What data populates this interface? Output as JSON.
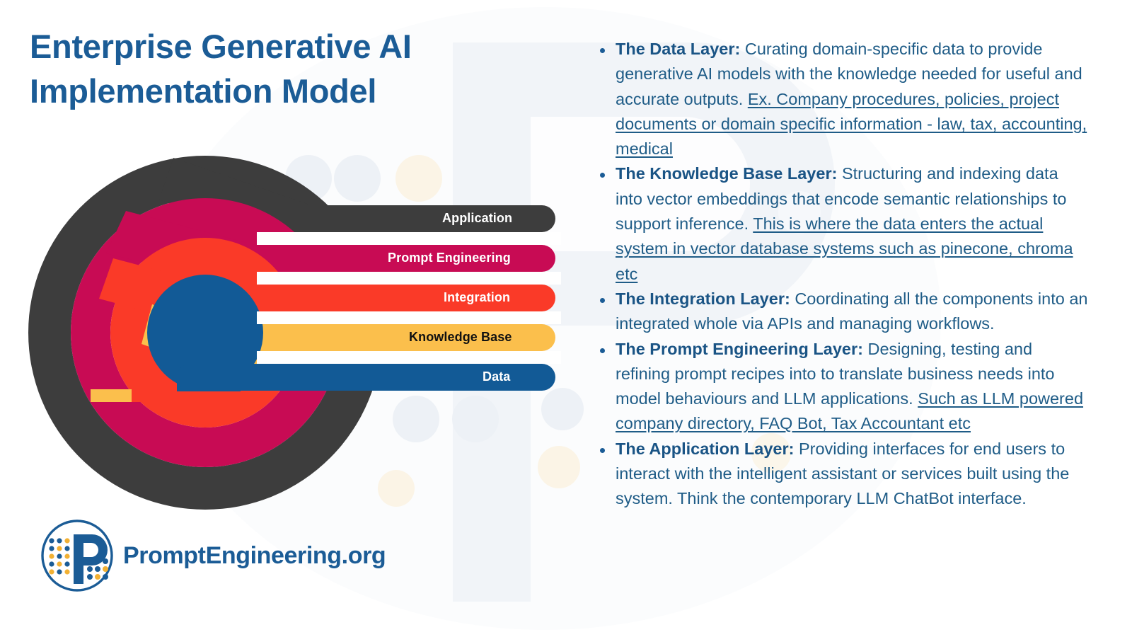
{
  "page": {
    "title_line1": "Enterprise Generative AI",
    "title_line2": "Implementation Model",
    "background": "#ffffff"
  },
  "colors": {
    "title_blue": "#1B5C96",
    "body_blue": "#1F5C87",
    "application": "#3D3D3D",
    "prompt_engineering": "#C80B54",
    "integration": "#FA3A28",
    "knowledge_base": "#FBBF4C",
    "data": "#125A96",
    "watermark_gray": "#F0F3F7",
    "decor_blue": "#EDF1F6",
    "decor_cream": "#FBF4E6"
  },
  "diagram": {
    "name": "concentric-layer-diagram",
    "layers": [
      {
        "id": "application",
        "label": "Application",
        "color": "#3D3D3D",
        "text_color": "#ffffff"
      },
      {
        "id": "prompt-engineering",
        "label": "Prompt Engineering",
        "color": "#C80B54",
        "text_color": "#ffffff"
      },
      {
        "id": "integration",
        "label": "Integration",
        "color": "#FA3A28",
        "text_color": "#ffffff"
      },
      {
        "id": "knowledge-base",
        "label": "Knowledge Base",
        "color": "#FBBF4C",
        "text_color": "#111111"
      },
      {
        "id": "data",
        "label": "Data",
        "color": "#125A96",
        "text_color": "#ffffff"
      }
    ]
  },
  "logo": {
    "brand": "PromptEngineering.org",
    "mark": "promptengineering-p-dots-logo"
  },
  "bullets": [
    {
      "id": "data-layer",
      "term": "The Data Layer:",
      "body": " Curating domain-specific data to provide generative AI models with the knowledge needed for useful and accurate outputs. ",
      "emphasis": "Ex. Company procedures, policies, project documents or domain specific information - law, tax, accounting, medical"
    },
    {
      "id": "knowledge-base-layer",
      "term": "The Knowledge Base Layer:",
      "body": " Structuring and indexing data into vector embeddings that encode semantic relationships to support inference. ",
      "emphasis": "This is where the data enters the actual system in vector database systems such as pinecone, chroma etc"
    },
    {
      "id": "integration-layer",
      "term": "The Integration Layer:",
      "body": " Coordinating all the components into an integrated whole via APIs and managing workflows.",
      "emphasis": ""
    },
    {
      "id": "prompt-engineering-layer",
      "term": "The Prompt Engineering Layer:",
      "body": " Designing, testing and refining prompt recipes into to translate business needs into model behaviours and LLM applications. ",
      "emphasis": "Such as  LLM powered company directory, FAQ Bot, Tax Accountant etc"
    },
    {
      "id": "application-layer",
      "term": "The Application Layer:",
      "body": " Providing interfaces for end users to interact with the intelligent assistant or services built using the system. Think the contemporary LLM ChatBot interface.",
      "emphasis": ""
    }
  ]
}
